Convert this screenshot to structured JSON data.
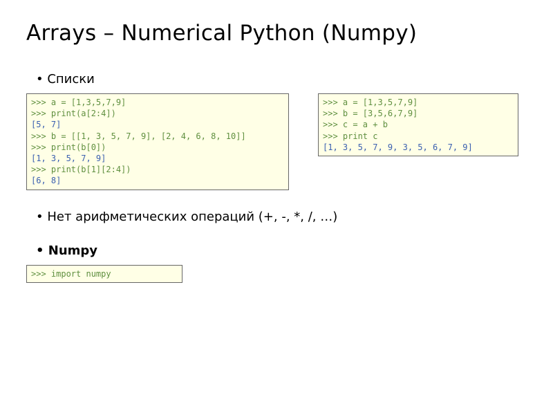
{
  "title": "Arrays – Numerical Python (Numpy)",
  "bullets": {
    "lists": "Списки",
    "noarith": "Нет арифметических операций (+, -, *, /, …)",
    "numpy": "Numpy"
  },
  "code": {
    "left": [
      {
        "p": ">>> ",
        "t": "a = [1,3,5,7,9]"
      },
      {
        "p": ">>> ",
        "t": "print(a[2:4])"
      },
      {
        "out": "[5, 7]"
      },
      {
        "p": ">>> ",
        "t": "b = [[1, 3, 5, 7, 9], [2, 4, 6, 8, 10]]"
      },
      {
        "p": ">>> ",
        "t": "print(b[0])"
      },
      {
        "out": "[1, 3, 5, 7, 9]"
      },
      {
        "p": ">>> ",
        "t": "print(b[1][2:4])"
      },
      {
        "out": "[6, 8]"
      }
    ],
    "right": [
      {
        "p": ">>> ",
        "t": "a = [1,3,5,7,9]"
      },
      {
        "p": ">>> ",
        "t": "b = [3,5,6,7,9]"
      },
      {
        "p": ">>> ",
        "t": "c = a + b"
      },
      {
        "p": ">>> ",
        "t": "print c"
      },
      {
        "out": "[1, 3, 5, 7, 9, 3, 5, 6, 7, 9]"
      }
    ],
    "import": [
      {
        "p": ">>> ",
        "t": "import numpy"
      }
    ]
  }
}
